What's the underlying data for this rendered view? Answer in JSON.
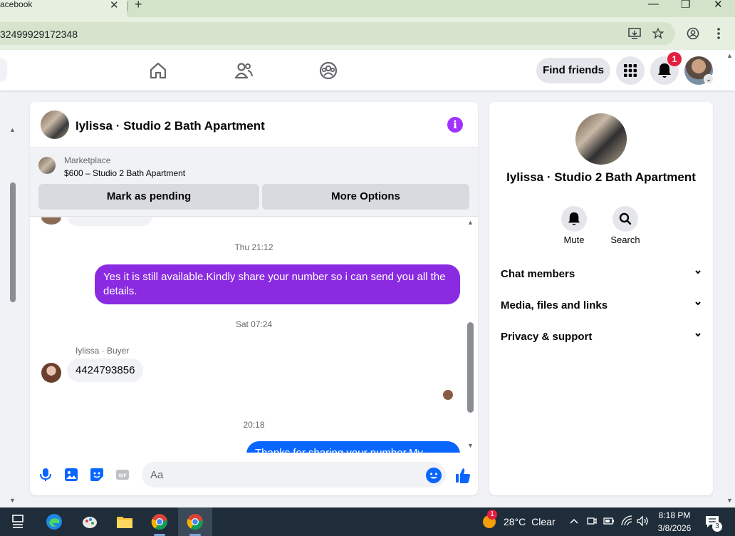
{
  "browser": {
    "tab_title": "acebook",
    "tab_close": "✕",
    "new_tab": "+",
    "url": "32499929172348",
    "window_minimize": "—",
    "window_maximize": "❐",
    "window_close": "✕"
  },
  "fb_nav": {
    "find_friends_label": "Find friends",
    "notification_count": "1"
  },
  "chat": {
    "title": "Iylissa · Studio 2 Bath Apartment",
    "info_label": "i",
    "marketplace": {
      "label": "Marketplace",
      "listing": "$600 – Studio 2 Bath Apartment",
      "mark_pending_label": "Mark as pending",
      "more_options_label": "More Options"
    },
    "messages": [
      {
        "type": "timestamp",
        "text": "Thu 21:12"
      },
      {
        "type": "outgoing",
        "text": "Yes it is still available.Kindly share your number so i can send you all the details."
      },
      {
        "type": "timestamp",
        "text": "Sat 07:24"
      },
      {
        "type": "incoming",
        "sender": "Iylissa · Buyer",
        "text": "4424793856"
      },
      {
        "type": "timestamp",
        "text": "20:18"
      },
      {
        "type": "outgoing",
        "text": "Thanks for sharing your number.My"
      }
    ],
    "composer_placeholder": "Aa"
  },
  "side_panel": {
    "name": "Iylissa · Studio 2 Bath Apartment",
    "mute_label": "Mute",
    "search_label": "Search",
    "sections": [
      {
        "label": "Chat members"
      },
      {
        "label": "Media, files and links"
      },
      {
        "label": "Privacy & support"
      }
    ]
  },
  "taskbar": {
    "weather_temp": "28°C",
    "weather_desc": "Clear",
    "weather_badge": "1",
    "time": "8:18 PM",
    "date": "3/8/2026",
    "notification_count": "3"
  },
  "colors": {
    "accent_purple": "#8a2be2",
    "messenger_blue": "#0866ff",
    "badge_red": "#e41e3f",
    "info_purple": "#a033ff"
  }
}
